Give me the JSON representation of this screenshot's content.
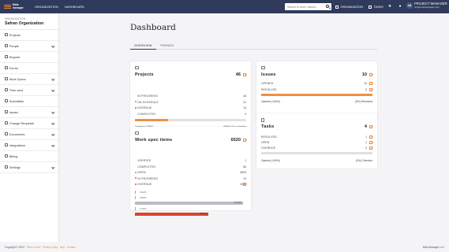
{
  "brand": {
    "logo_line1": "Meta",
    "logo_line2": "manager"
  },
  "topnav": {
    "organization": "ORGANIZATION",
    "dashboard": "DASHBOARD"
  },
  "search": {
    "placeholder": "Search in docs, issues..."
  },
  "header_links": {
    "organization": "ORGANIZATION",
    "tasks": "TASKS"
  },
  "user": {
    "initials": "PM",
    "name": "PROJECT MANAGER",
    "email": "pm@metamanager.com"
  },
  "sidebar": {
    "org_label": "ORGANIZATION",
    "org_name": "Safran Organization",
    "items": [
      {
        "label": "Projects",
        "icon": "folder-icon",
        "chevron": false
      },
      {
        "label": "People",
        "icon": "people-icon",
        "chevron": true
      },
      {
        "label": "Reports",
        "icon": "report-icon",
        "chevron": false
      },
      {
        "label": "Forms",
        "icon": "form-icon",
        "chevron": false
      },
      {
        "label": "Work Specs",
        "icon": "spec-icon",
        "chevron": true
      },
      {
        "label": "Time card",
        "icon": "clock-icon",
        "chevron": true
      },
      {
        "label": "Submittals",
        "icon": "submittal-icon",
        "chevron": false
      },
      {
        "label": "Issues",
        "icon": "issue-icon",
        "chevron": true
      },
      {
        "label": "Change Requests",
        "icon": "change-icon",
        "chevron": true
      },
      {
        "label": "Documents",
        "icon": "document-icon",
        "chevron": true
      },
      {
        "label": "Integrations",
        "icon": "plug-icon",
        "chevron": true
      },
      {
        "label": "Billing",
        "icon": "billing-icon",
        "chevron": false
      },
      {
        "label": "Settings",
        "icon": "gear-icon",
        "chevron": true
      }
    ]
  },
  "page": {
    "title": "Dashboard",
    "tabs": [
      "OVERVIEW",
      "TRENDS"
    ]
  },
  "projects": {
    "title": "Projects",
    "count": "46",
    "rows": [
      {
        "label": "IN PROGRESS",
        "value": "46",
        "dot": ""
      },
      {
        "label": "ON SCHEDULE",
        "value": "31",
        "dot": "#7aa37a"
      },
      {
        "label": "OVERDUE",
        "value": "14",
        "dot": "#e0573a"
      },
      {
        "label": "COMPLETED",
        "value": "0",
        "dot": ""
      }
    ],
    "progress": 0.3,
    "foot_left": "Overdue (30%)",
    "foot_right": "(69%) On schedule"
  },
  "issues": {
    "title": "Issues",
    "count": "10",
    "rows": [
      {
        "label": "OPENED",
        "value": "10"
      },
      {
        "label": "RESOLVED",
        "value": "0"
      }
    ],
    "progress": 1.0,
    "foot_left": "Opened (100%)",
    "foot_right": "(0%) Resolved"
  },
  "tasks": {
    "title": "Tasks",
    "count": "4",
    "rows": [
      {
        "label": "RESOLVED",
        "value": "1"
      },
      {
        "label": "OPEN",
        "value": "2"
      },
      {
        "label": "OVERDUE",
        "value": "0"
      }
    ],
    "progress": 0.0,
    "foot_left": "Opened (100%)",
    "foot_right": "(0%) Overdue"
  },
  "work_spec": {
    "title": "Work spec items",
    "count": "6520",
    "rows": [
      {
        "label": "VERIFIED",
        "value": "1",
        "dot": ""
      },
      {
        "label": "COMPLETED",
        "value": "56",
        "dot": ""
      },
      {
        "label": "OPEN",
        "value": "6520",
        "dot": "#7aa37a"
      },
      {
        "label": "IN PROGRESS",
        "value": "10",
        "dot": "#e0573a"
      },
      {
        "label": "OVERDUE",
        "value": "4088",
        "dot": "#e0573a"
      }
    ],
    "bars": [
      {
        "pct": "0.02%",
        "fraction": 0.0002,
        "color": "#a8a8ad",
        "label": ""
      },
      {
        "pct": "0.86%",
        "fraction": 0.0086,
        "color": "#a8a8ad",
        "label": ""
      },
      {
        "pct": "",
        "fraction": 0.9712,
        "color": "#b9bcc2",
        "label": "97.12%"
      },
      {
        "pct": "0.15%",
        "fraction": 0.0015,
        "color": "#a8a8ad",
        "label": ""
      },
      {
        "pct": "",
        "fraction": 0.6574,
        "color": "#d9452f",
        "label": "65.74%"
      }
    ]
  },
  "footer": {
    "copyright": "Copyright © 2023",
    "links": [
      "Terms of use",
      "Privacy policy",
      "Help",
      "Contact"
    ],
    "right": "Meta Manager LLC"
  },
  "colors": {
    "navy": "#2f3a5c",
    "accent": "#f08a3c",
    "red": "#d9452f"
  }
}
